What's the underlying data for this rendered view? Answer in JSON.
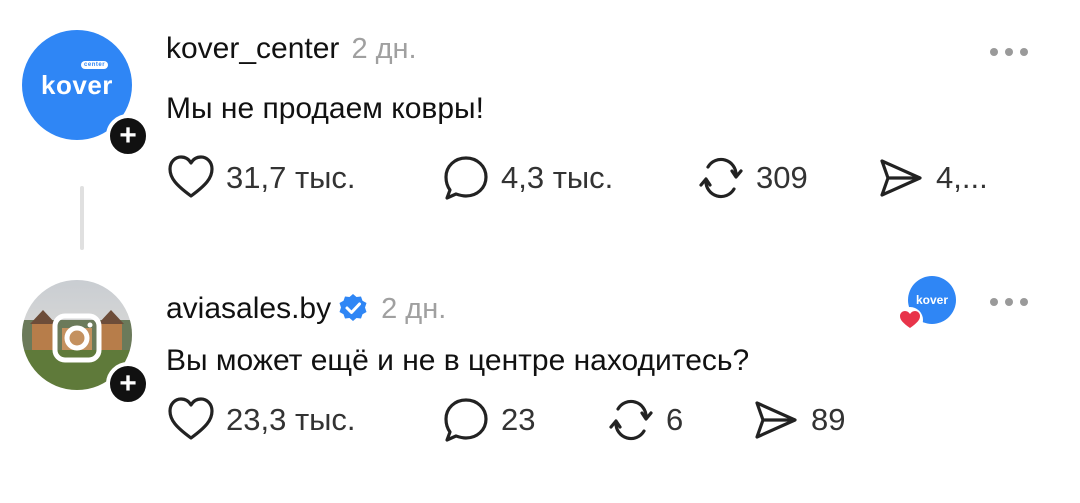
{
  "posts": [
    {
      "username": "kover_center",
      "time": "2 дн.",
      "text": "Мы не продаем ковры!",
      "avatar_logo": "kover",
      "avatar_pill": "center",
      "likes": "31,7 тыс.",
      "comments": "4,3 тыс.",
      "reposts": "309",
      "shares": "4,..."
    },
    {
      "username": "aviasales.by",
      "verified": true,
      "time": "2 дн.",
      "text": "Вы может ещё и не в центре находитесь?",
      "mini_avatar_logo": "kover",
      "likes": "23,3 тыс.",
      "comments": "23",
      "reposts": "6",
      "shares": "89"
    }
  ],
  "icons": [
    "heart-icon",
    "comment-icon",
    "repost-icon",
    "share-icon",
    "more-icon",
    "verified-icon",
    "plus-icon"
  ],
  "colors": {
    "accent": "#2f86f5",
    "muted": "#a0a0a0",
    "heart": "#e8344a"
  }
}
